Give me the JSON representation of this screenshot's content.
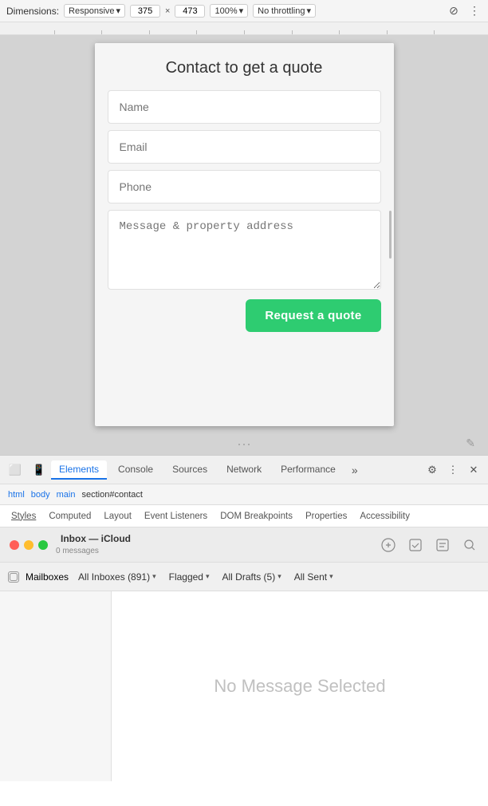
{
  "toolbar": {
    "dimensions_label": "Dimensions:",
    "responsive_label": "Responsive",
    "width_value": "375",
    "height_value": "473",
    "zoom_value": "100%",
    "throttle_label": "No throttling",
    "chevron": "▾",
    "x_sep": "×"
  },
  "preview": {
    "form": {
      "title": "Contact to get a quote",
      "name_placeholder": "Name",
      "email_placeholder": "Email",
      "phone_placeholder": "Phone",
      "message_placeholder": "Message & property address",
      "button_label": "Request a quote"
    }
  },
  "devtools": {
    "tabs": [
      {
        "label": "Elements",
        "active": true
      },
      {
        "label": "Console"
      },
      {
        "label": "Sources"
      },
      {
        "label": "Network"
      },
      {
        "label": "Performance"
      }
    ],
    "more_label": "»",
    "close_label": "✕",
    "settings_label": "⚙",
    "kebab_label": "⋮",
    "breadcrumbs": [
      {
        "label": "html"
      },
      {
        "label": "body"
      },
      {
        "label": "main"
      },
      {
        "label": "section#contact",
        "active": true
      }
    ],
    "sub_tabs": [
      {
        "label": "Styles"
      },
      {
        "label": "Computed"
      },
      {
        "label": "Layout"
      },
      {
        "label": "Event Listeners"
      },
      {
        "label": "DOM Breakpoints"
      },
      {
        "label": "Properties"
      },
      {
        "label": "Accessibility"
      }
    ]
  },
  "mail": {
    "app_title": "Inbox — iCloud",
    "app_subtitle": "0 messages",
    "traffic_lights": {
      "red": "#ff5f57",
      "yellow": "#ffbd2e",
      "green": "#28c840"
    },
    "icons": [
      "✉",
      "✏",
      "☑",
      "🔍"
    ],
    "filter_bar": {
      "mailboxes_label": "Mailboxes",
      "all_inboxes": "All Inboxes (891)",
      "flagged": "Flagged",
      "all_drafts": "All Drafts (5)",
      "all_sent": "All Sent"
    },
    "no_message_text": "No Message Selected"
  }
}
